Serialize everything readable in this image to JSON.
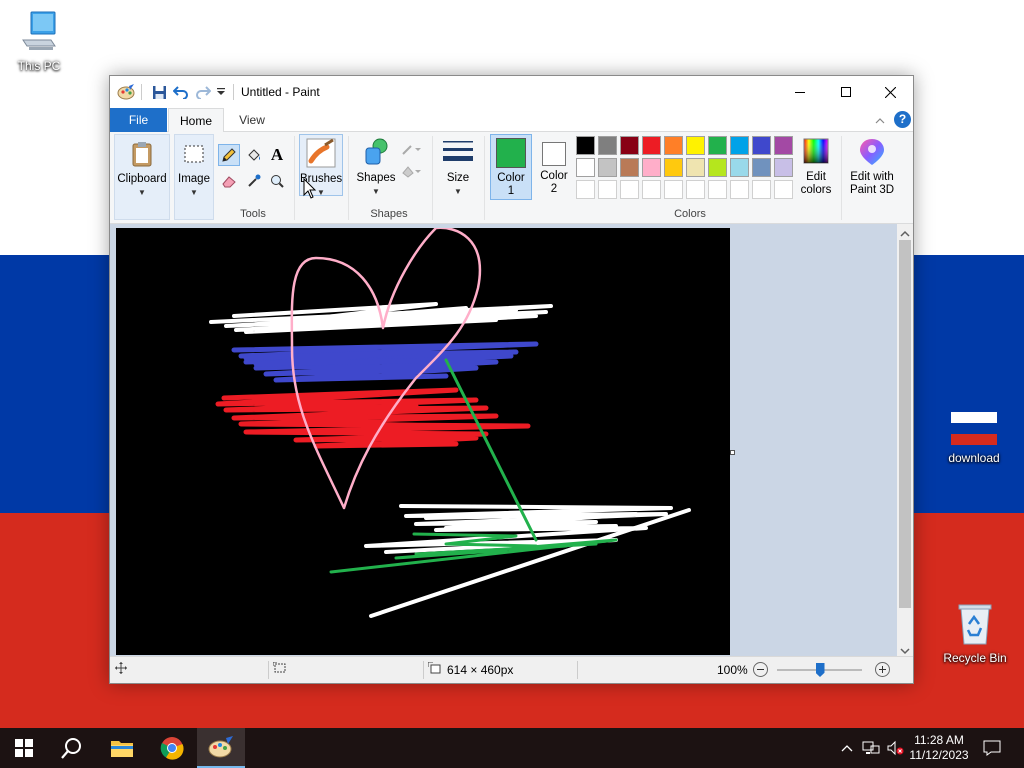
{
  "desktop": {
    "icons": [
      {
        "label": "This PC"
      },
      {
        "label": "download"
      },
      {
        "label": "Recycle Bin"
      }
    ]
  },
  "window": {
    "title": "Untitled - Paint",
    "tabs": {
      "file": "File",
      "home": "Home",
      "view": "View"
    },
    "ribbon": {
      "clipboard": "Clipboard",
      "image": "Image",
      "brushes": "Brushes",
      "shapes": "Shapes",
      "size": "Size",
      "color1": "Color 1",
      "color2": "Color 2",
      "edit_colors": "Edit colors",
      "edit_3d": "Edit with Paint 3D",
      "groups": {
        "tools": "Tools",
        "shapes": "Shapes",
        "colors": "Colors"
      },
      "palette_row1": [
        "#000000",
        "#7f7f7f",
        "#880015",
        "#ed1c24",
        "#ff7f27",
        "#fff200",
        "#22b14c",
        "#00a2e8",
        "#3f48cc",
        "#a349a4"
      ],
      "palette_row2": [
        "#ffffff",
        "#c3c3c3",
        "#b97a57",
        "#ffaec9",
        "#ffc90e",
        "#efe4b0",
        "#b5e61d",
        "#99d9ea",
        "#7092be",
        "#c8bfe7"
      ],
      "color1_value": "#22b14c",
      "color2_value": "#ffffff"
    },
    "status": {
      "canvas_size": "614 × 460px",
      "zoom": "100%",
      "zoom_level": 0.5
    }
  },
  "taskbar": {
    "time": "11:28 AM",
    "date": "11/12/2023"
  }
}
